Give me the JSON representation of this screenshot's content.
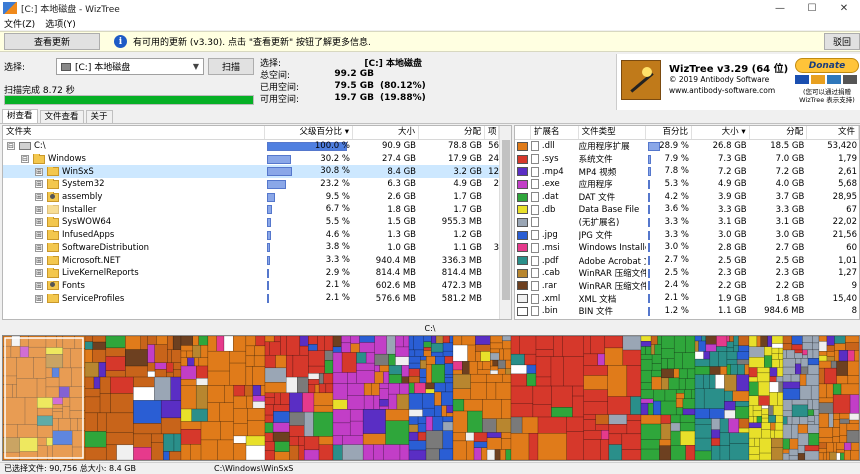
{
  "window": {
    "title": "[C:] 本地磁盘  - WizTree"
  },
  "menu": {
    "items": [
      "文件(Z)",
      "选项(Y)"
    ]
  },
  "notice": {
    "check_label": "查看更新",
    "message": "有可用的更新 (v3.30). 点击 \"查看更新\" 按钮了解更多信息.",
    "dismiss_label": "驳回"
  },
  "scan": {
    "select_label": "选择:",
    "drive_value": "[C:] 本地磁盘",
    "scan_label": "扫描",
    "status": "扫描完成 8.72 秒",
    "progress": 1.0
  },
  "stats": {
    "select_label": "选择:",
    "drive": "[C:] 本地磁盘",
    "rows": [
      {
        "k": "总空间:",
        "v": "99.2 GB",
        "p": ""
      },
      {
        "k": "已用空间:",
        "v": "79.5 GB",
        "p": "(80.12%)"
      },
      {
        "k": "可用空间:",
        "v": "19.7 GB",
        "p": "(19.88%)"
      }
    ]
  },
  "about": {
    "name": "WizTree v3.29 (64 位)",
    "copyright": "© 2019 Antibody Software",
    "site": "www.antibody-software.com",
    "donate": "Donate",
    "donate_note": "(您可以通过捐赠 WizTree 表示支持)"
  },
  "tabs": [
    "树查看",
    "文件查看",
    "关于"
  ],
  "tree": {
    "headers": {
      "name": "文件夹",
      "pct": "父级百分比",
      "size": "大小",
      "alloc": "分配",
      "items": "项"
    },
    "rows": [
      {
        "name": "C:\\",
        "pct": "100.0 %",
        "frac": 1.0,
        "size": "90.9 GB",
        "alloc": "78.8 GB",
        "items": "56",
        "icon": "drive",
        "exp": "⊟",
        "indent": 0
      },
      {
        "name": "Windows",
        "pct": "30.2 %",
        "frac": 0.302,
        "size": "27.4 GB",
        "alloc": "17.9 GB",
        "items": "24",
        "icon": "folder",
        "exp": "⊟",
        "indent": 1
      },
      {
        "name": "WinSxS",
        "pct": "30.8 %",
        "frac": 0.308,
        "size": "8.4 GB",
        "alloc": "3.2 GB",
        "items": "12",
        "icon": "folder",
        "exp": "⊞",
        "indent": 2,
        "sel": true
      },
      {
        "name": "System32",
        "pct": "23.2 %",
        "frac": 0.232,
        "size": "6.3 GB",
        "alloc": "4.9 GB",
        "items": "2",
        "icon": "folder",
        "exp": "⊞",
        "indent": 2
      },
      {
        "name": "assembly",
        "pct": "9.5 %",
        "frac": 0.095,
        "size": "2.6 GB",
        "alloc": "1.7 GB",
        "items": "",
        "icon": "gear",
        "exp": "⊞",
        "indent": 2
      },
      {
        "name": "Installer",
        "pct": "6.7 %",
        "frac": 0.067,
        "size": "1.8 GB",
        "alloc": "1.7 GB",
        "items": "",
        "icon": "hidden",
        "exp": "⊞",
        "indent": 2
      },
      {
        "name": "SysWOW64",
        "pct": "5.5 %",
        "frac": 0.055,
        "size": "1.5 GB",
        "alloc": "955.3 MB",
        "items": "",
        "icon": "folder",
        "exp": "⊞",
        "indent": 2
      },
      {
        "name": "InfusedApps",
        "pct": "4.6 %",
        "frac": 0.046,
        "size": "1.3 GB",
        "alloc": "1.2 GB",
        "items": "",
        "icon": "folder",
        "exp": "⊞",
        "indent": 2
      },
      {
        "name": "SoftwareDistribution",
        "pct": "3.8 %",
        "frac": 0.038,
        "size": "1.0 GB",
        "alloc": "1.1 GB",
        "items": "3",
        "icon": "folder",
        "exp": "⊞",
        "indent": 2
      },
      {
        "name": "Microsoft.NET",
        "pct": "3.3 %",
        "frac": 0.033,
        "size": "940.4 MB",
        "alloc": "336.3 MB",
        "items": "",
        "icon": "folder",
        "exp": "⊞",
        "indent": 2
      },
      {
        "name": "LiveKernelReports",
        "pct": "2.9 %",
        "frac": 0.029,
        "size": "814.4 MB",
        "alloc": "814.4 MB",
        "items": "",
        "icon": "folder",
        "exp": "⊞",
        "indent": 2
      },
      {
        "name": "Fonts",
        "pct": "2.1 %",
        "frac": 0.021,
        "size": "602.6 MB",
        "alloc": "472.3 MB",
        "items": "",
        "icon": "gear",
        "exp": "⊞",
        "indent": 2
      },
      {
        "name": "ServiceProfiles",
        "pct": "2.1 %",
        "frac": 0.021,
        "size": "576.6 MB",
        "alloc": "581.2 MB",
        "items": "",
        "icon": "folder",
        "exp": "⊞",
        "indent": 2
      }
    ]
  },
  "ext": {
    "headers": {
      "ext": "扩展名",
      "type": "文件类型",
      "pct": "百分比",
      "size": "大小",
      "alloc": "分配",
      "files": "文件"
    },
    "rows": [
      {
        "color": "#e07b1a",
        "ext": ".dll",
        "type": "应用程序扩展",
        "pct": "28.9 %",
        "frac": 0.289,
        "size": "26.8 GB",
        "alloc": "18.5 GB",
        "files": "53,420"
      },
      {
        "color": "#d6382b",
        "ext": ".sys",
        "type": "系统文件",
        "pct": "7.9 %",
        "frac": 0.079,
        "size": "7.3 GB",
        "alloc": "7.0 GB",
        "files": "1,79"
      },
      {
        "color": "#5a2ec4",
        "ext": ".mp4",
        "type": "MP4 视频",
        "pct": "7.8 %",
        "frac": 0.078,
        "size": "7.2 GB",
        "alloc": "7.2 GB",
        "files": "2,61"
      },
      {
        "color": "#c23ec7",
        "ext": ".exe",
        "type": "应用程序",
        "pct": "5.3 %",
        "frac": 0.053,
        "size": "4.9 GB",
        "alloc": "4.0 GB",
        "files": "5,68"
      },
      {
        "color": "#2fa63b",
        "ext": ".dat",
        "type": "DAT 文件",
        "pct": "4.2 %",
        "frac": 0.042,
        "size": "3.9 GB",
        "alloc": "3.7 GB",
        "files": "28,95"
      },
      {
        "color": "#e8e02a",
        "ext": ".db",
        "type": "Data Base File",
        "pct": "3.6 %",
        "frac": 0.036,
        "size": "3.3 GB",
        "alloc": "3.3 GB",
        "files": "67"
      },
      {
        "color": "#9aa6b5",
        "ext": "",
        "type": "(无扩展名)",
        "pct": "3.3 %",
        "frac": 0.033,
        "size": "3.1 GB",
        "alloc": "3.1 GB",
        "files": "22,02"
      },
      {
        "color": "#2a5ed4",
        "ext": ".jpg",
        "type": "JPG 文件",
        "pct": "3.3 %",
        "frac": 0.033,
        "size": "3.0 GB",
        "alloc": "3.0 GB",
        "files": "21,56"
      },
      {
        "color": "#e63a8c",
        "ext": ".msi",
        "type": "Windows Installer",
        "pct": "3.0 %",
        "frac": 0.03,
        "size": "2.8 GB",
        "alloc": "2.7 GB",
        "files": "60"
      },
      {
        "color": "#2a8f8a",
        "ext": ".pdf",
        "type": "Adobe Acrobat 文",
        "pct": "2.7 %",
        "frac": 0.027,
        "size": "2.5 GB",
        "alloc": "2.5 GB",
        "files": "1,01"
      },
      {
        "color": "#b8862f",
        "ext": ".cab",
        "type": "WinRAR 压缩文件",
        "pct": "2.5 %",
        "frac": 0.025,
        "size": "2.3 GB",
        "alloc": "2.3 GB",
        "files": "1,27"
      },
      {
        "color": "#6d4020",
        "ext": ".rar",
        "type": "WinRAR 压缩文件",
        "pct": "2.4 %",
        "frac": 0.024,
        "size": "2.2 GB",
        "alloc": "2.2 GB",
        "files": "9"
      },
      {
        "color": "#f0f0f0",
        "ext": ".xml",
        "type": "XML 文档",
        "pct": "2.1 %",
        "frac": 0.021,
        "size": "1.9 GB",
        "alloc": "1.8 GB",
        "files": "15,40"
      },
      {
        "color": "#ffffff",
        "ext": ".bin",
        "type": "BIN 文件",
        "pct": "1.2 %",
        "frac": 0.012,
        "size": "1.1 GB",
        "alloc": "984.6 MB",
        "files": "8"
      }
    ]
  },
  "path_label": "C:\\",
  "status": {
    "left": "已选择文件: 90,756  总大小: 8.4 GB",
    "right": "C:\\Windows\\WinSxS"
  }
}
